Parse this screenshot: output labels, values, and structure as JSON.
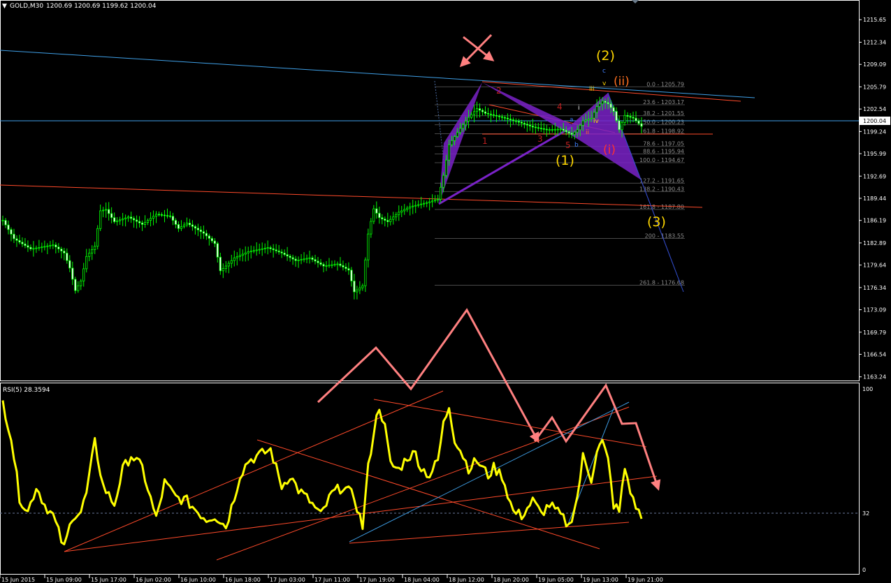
{
  "header": {
    "symbol_timeframe": "GOLD,M30",
    "ohlc": "1200.69 1200.69 1199.62 1200.04"
  },
  "current_price_label": "1200.04",
  "rsi_header": "RSI(5) 28.3594",
  "colors": {
    "background": "#000000",
    "candle": "#00ff00",
    "rsi_line": "#ffff00",
    "pattern_fill": "#7a22c8",
    "trend_blue": "#3fa0e8",
    "trend_red": "#ff4a2a",
    "arrow_pink": "#ff8080",
    "wave_yellow": "#ffd700",
    "wave_red": "#ff3030",
    "wave_blue": "#3f7fff",
    "fib_text": "#8c8c8c",
    "grid_axis": "#ffffff"
  },
  "chart_data": [
    {
      "type": "candlestick",
      "title": "GOLD,M30",
      "y_ticks": [
        "1215.65",
        "1212.34",
        "1209.09",
        "1205.79",
        "1202.54",
        "1199.24",
        "1195.99",
        "1192.69",
        "1189.44",
        "1186.19",
        "1182.89",
        "1179.64",
        "1176.34",
        "1173.09",
        "1169.79",
        "1166.54",
        "1163.24"
      ],
      "ylim": [
        1162.9,
        1216.9
      ],
      "x_labels": [
        "15 Jun 2015",
        "15 Jun 09:00",
        "15 Jun 17:00",
        "16 Jun 02:00",
        "16 Jun 10:00",
        "16 Jun 18:00",
        "17 Jun 03:00",
        "17 Jun 11:00",
        "17 Jun 19:00",
        "18 Jun 04:00",
        "18 Jun 12:00",
        "18 Jun 20:00",
        "19 Jun 05:00",
        "19 Jun 13:00",
        "19 Jun 21:00"
      ],
      "bar_count": 230,
      "price_anchors": [
        [
          0,
          1186.2
        ],
        [
          4,
          1183.5
        ],
        [
          10,
          1182.0
        ],
        [
          18,
          1182.6
        ],
        [
          22,
          1181.4
        ],
        [
          24,
          1179.2
        ],
        [
          26,
          1175.9
        ],
        [
          28,
          1177.3
        ],
        [
          30,
          1180.9
        ],
        [
          33,
          1182.4
        ],
        [
          35,
          1187.6
        ],
        [
          37,
          1187.8
        ],
        [
          40,
          1186.0
        ],
        [
          45,
          1186.7
        ],
        [
          50,
          1185.6
        ],
        [
          55,
          1187.1
        ],
        [
          60,
          1186.8
        ],
        [
          63,
          1185.0
        ],
        [
          66,
          1185.8
        ],
        [
          72,
          1184.3
        ],
        [
          76,
          1182.8
        ],
        [
          78,
          1178.8
        ],
        [
          80,
          1179.5
        ],
        [
          83,
          1180.7
        ],
        [
          88,
          1181.6
        ],
        [
          95,
          1182.2
        ],
        [
          100,
          1181.4
        ],
        [
          105,
          1180.3
        ],
        [
          110,
          1180.7
        ],
        [
          115,
          1179.5
        ],
        [
          120,
          1179.8
        ],
        [
          124,
          1178.9
        ],
        [
          126,
          1175.7
        ],
        [
          129,
          1176.6
        ],
        [
          131,
          1184.2
        ],
        [
          133,
          1187.9
        ],
        [
          135,
          1186.6
        ],
        [
          138,
          1186.0
        ],
        [
          142,
          1187.4
        ],
        [
          146,
          1188.2
        ],
        [
          152,
          1188.8
        ],
        [
          156,
          1189.3
        ],
        [
          158,
          1192.8
        ],
        [
          160,
          1197.3
        ],
        [
          164,
          1199.7
        ],
        [
          167,
          1201.3
        ],
        [
          170,
          1202.6
        ],
        [
          173,
          1201.9
        ],
        [
          176,
          1201.6
        ],
        [
          180,
          1201.2
        ],
        [
          185,
          1200.6
        ],
        [
          190,
          1199.9
        ],
        [
          195,
          1199.5
        ],
        [
          200,
          1199.6
        ],
        [
          204,
          1198.8
        ],
        [
          206,
          1199.5
        ],
        [
          208,
          1200.8
        ],
        [
          211,
          1201.2
        ],
        [
          213,
          1202.9
        ],
        [
          215,
          1203.7
        ],
        [
          217,
          1203.3
        ],
        [
          219,
          1202.2
        ],
        [
          221,
          1199.5
        ],
        [
          223,
          1201.6
        ],
        [
          226,
          1201.2
        ],
        [
          229,
          1200.0
        ]
      ],
      "fib_levels": [
        {
          "label": "0.0 - 1205.79",
          "price": 1205.79
        },
        {
          "label": "23.6 - 1203.17",
          "price": 1203.17
        },
        {
          "label": "38.2 - 1201.55",
          "price": 1201.55
        },
        {
          "label": "50.0 - 1200.23",
          "price": 1200.23
        },
        {
          "label": "61.8 - 1198.92",
          "price": 1198.92
        },
        {
          "label": "78.6 - 1197.05",
          "price": 1197.05
        },
        {
          "label": "88.6 - 1195.94",
          "price": 1195.94
        },
        {
          "label": "100.0 - 1194.67",
          "price": 1194.67
        },
        {
          "label": "127.2 - 1191.65",
          "price": 1191.65
        },
        {
          "label": "138.2 - 1190.43",
          "price": 1190.43
        },
        {
          "label": "161.8 - 1187.80",
          "price": 1187.8
        },
        {
          "label": "200 - 1183.55",
          "price": 1183.55
        },
        {
          "label": "261.8 - 1176.68",
          "price": 1176.68
        }
      ],
      "wave_labels_yellow": [
        "(1)",
        "(2)",
        "(3)"
      ],
      "wave_labels_red_circled": [
        "(i)",
        "(ii)"
      ],
      "wave_labels_red_digits": [
        "1",
        "2",
        "3",
        "4",
        "5"
      ],
      "wave_labels_small": [
        "i",
        "ii",
        "iii",
        "iv",
        "v",
        "a",
        "b",
        "c"
      ]
    },
    {
      "type": "line",
      "title": "RSI(5) 28.3594",
      "ylim": [
        0,
        100
      ],
      "y_ticks": [
        "100",
        "32",
        "0"
      ],
      "level_line": 32,
      "rsi_anchors": [
        [
          0,
          92
        ],
        [
          3,
          73
        ],
        [
          6,
          40
        ],
        [
          9,
          32
        ],
        [
          12,
          46
        ],
        [
          15,
          36
        ],
        [
          18,
          30
        ],
        [
          22,
          12
        ],
        [
          25,
          30
        ],
        [
          28,
          32
        ],
        [
          30,
          42
        ],
        [
          33,
          70
        ],
        [
          36,
          46
        ],
        [
          40,
          36
        ],
        [
          43,
          55
        ],
        [
          46,
          63
        ],
        [
          50,
          56
        ],
        [
          55,
          28
        ],
        [
          58,
          48
        ],
        [
          62,
          40
        ],
        [
          66,
          38
        ],
        [
          70,
          32
        ],
        [
          73,
          28
        ],
        [
          76,
          30
        ],
        [
          80,
          24
        ],
        [
          83,
          40
        ],
        [
          85,
          52
        ],
        [
          88,
          60
        ],
        [
          92,
          63
        ],
        [
          96,
          66
        ],
        [
          100,
          46
        ],
        [
          103,
          52
        ],
        [
          106,
          44
        ],
        [
          110,
          38
        ],
        [
          114,
          30
        ],
        [
          118,
          42
        ],
        [
          122,
          46
        ],
        [
          126,
          40
        ],
        [
          129,
          24
        ],
        [
          131,
          56
        ],
        [
          133,
          76
        ],
        [
          135,
          90
        ],
        [
          137,
          78
        ],
        [
          139,
          58
        ],
        [
          142,
          55
        ],
        [
          145,
          62
        ],
        [
          148,
          64
        ],
        [
          150,
          56
        ],
        [
          153,
          52
        ],
        [
          156,
          60
        ],
        [
          158,
          80
        ],
        [
          160,
          90
        ],
        [
          162,
          72
        ],
        [
          164,
          66
        ],
        [
          167,
          56
        ],
        [
          170,
          60
        ],
        [
          174,
          52
        ],
        [
          176,
          56
        ],
        [
          179,
          52
        ],
        [
          183,
          32
        ],
        [
          186,
          30
        ],
        [
          190,
          38
        ],
        [
          193,
          31
        ],
        [
          196,
          36
        ],
        [
          200,
          30
        ],
        [
          203,
          24
        ],
        [
          206,
          40
        ],
        [
          208,
          62
        ],
        [
          211,
          50
        ],
        [
          213,
          66
        ],
        [
          215,
          70
        ],
        [
          217,
          60
        ],
        [
          219,
          36
        ],
        [
          221,
          32
        ],
        [
          223,
          56
        ],
        [
          226,
          38
        ],
        [
          228,
          32
        ],
        [
          229,
          28
        ]
      ]
    }
  ]
}
